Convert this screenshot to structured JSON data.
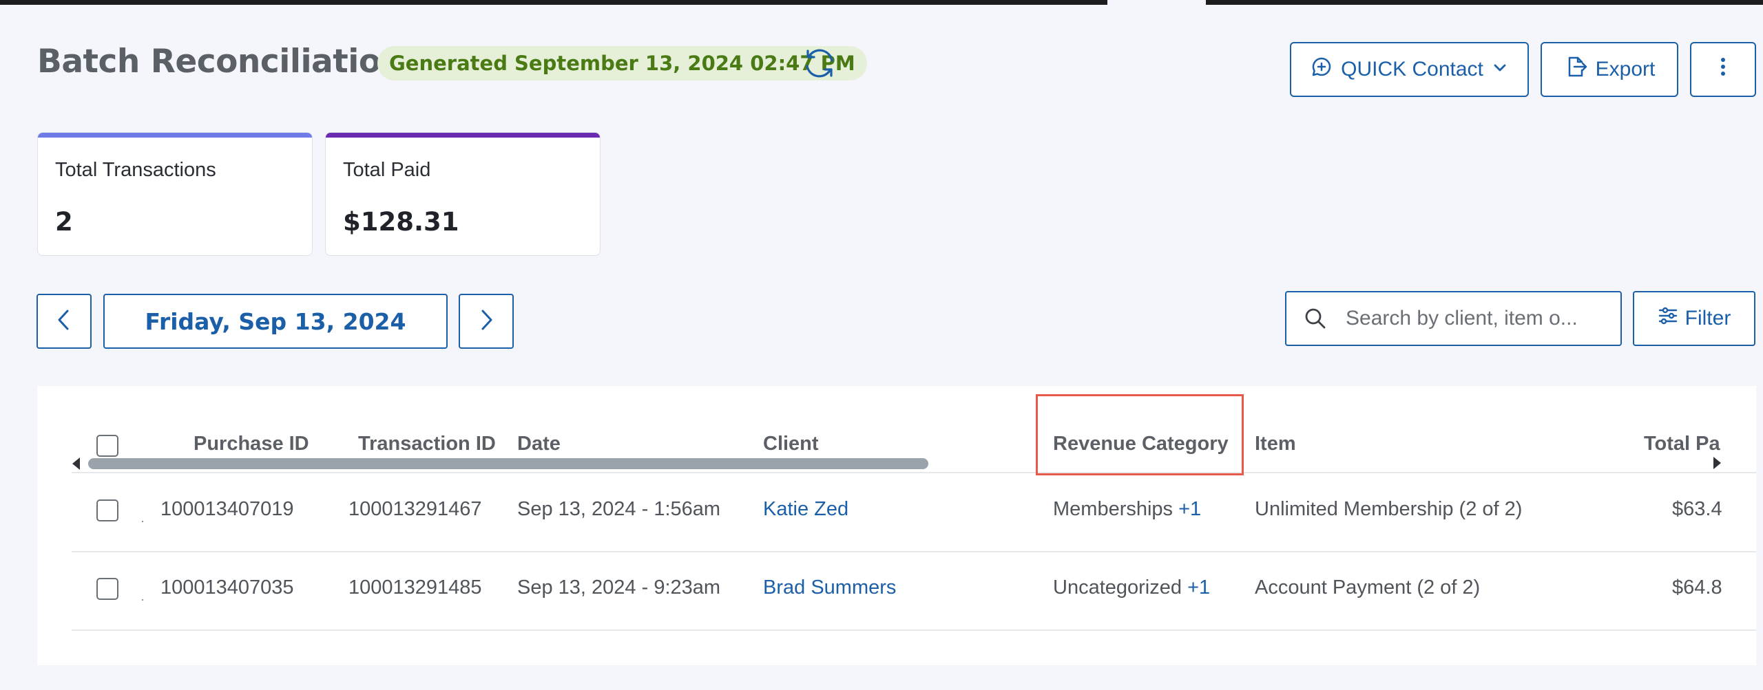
{
  "header": {
    "title": "Batch Reconciliation",
    "generated": "Generated September 13, 2024 02:47 PM",
    "quick_contact_label": "QUICK Contact",
    "export_label": "Export"
  },
  "summary_cards": [
    {
      "label": "Total Transactions",
      "value": "2",
      "accent": "#6f7be6"
    },
    {
      "label": "Total Paid",
      "value": "$128.31",
      "accent": "#6a2bb0"
    }
  ],
  "date_nav": {
    "current": "Friday, Sep 13, 2024"
  },
  "search": {
    "placeholder": "Search by client, item o..."
  },
  "filter_label": "Filter",
  "table": {
    "columns": [
      "Purchase ID",
      "Transaction ID",
      "Date",
      "Client",
      "Revenue Category",
      "Item",
      "Total Pa"
    ],
    "rows": [
      {
        "purchase_id": "100013407019",
        "transaction_id": "100013291467",
        "date": "Sep 13, 2024 - 1:56am",
        "client": "Katie Zed",
        "revenue_category": "Memberships",
        "revenue_extra": "+1",
        "item": "Unlimited Membership (2 of 2)",
        "total": "$63.4"
      },
      {
        "purchase_id": "100013407035",
        "transaction_id": "100013291485",
        "date": "Sep 13, 2024 - 9:23am",
        "client": "Brad Summers",
        "revenue_category": "Uncategorized",
        "revenue_extra": "+1",
        "item": "Account Payment (2 of 2)",
        "total": "$64.8"
      }
    ]
  },
  "icons": [
    "refresh-icon",
    "chat-plus-icon",
    "chevron-down-icon",
    "export-icon",
    "more-vertical-icon",
    "chevron-left-icon",
    "chevron-right-icon",
    "search-icon",
    "sliders-icon"
  ],
  "colors": {
    "primary": "#1b5fa8",
    "badge_bg": "#e6f0d9",
    "badge_text": "#4a7a14",
    "highlight": "#e8594a"
  }
}
